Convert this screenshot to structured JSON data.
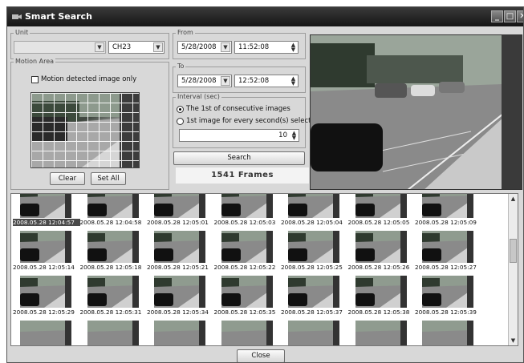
{
  "window": {
    "title": "Smart Search"
  },
  "unit": {
    "label": "Unit",
    "site_value": "",
    "channel_value": "CH23"
  },
  "motion_area": {
    "label": "Motion Area",
    "checkbox_label": "Motion detected image only",
    "checked": false,
    "clear_label": "Clear",
    "set_all_label": "Set All"
  },
  "from": {
    "label": "From",
    "date": "5/28/2008",
    "time": "11:52:08"
  },
  "to": {
    "label": "To",
    "date": "5/28/2008",
    "time": "12:52:08"
  },
  "interval": {
    "label": "Interval (sec)",
    "options": [
      "The 1st of consecutive images",
      "1st image for every second(s) selected"
    ],
    "selected_index": 0,
    "seconds": "10"
  },
  "search": {
    "button_label": "Search",
    "frames_text": "1541 Frames"
  },
  "thumbnails": {
    "captions": [
      [
        "2008.05.28 12:04:57",
        "2008.05.28 12:04:58",
        "2008.05.28 12:05:01",
        "2008.05.28 12:05:03",
        "2008.05.28 12:05:04",
        "2008.05.28 12:05:05",
        "2008.05.28 12:05:09"
      ],
      [
        "2008.05.28 12:05:14",
        "2008.05.28 12:05:18",
        "2008.05.28 12:05:21",
        "2008.05.28 12:05:22",
        "2008.05.28 12:05:25",
        "2008.05.28 12:05:26",
        "2008.05.28 12:05:27"
      ],
      [
        "2008.05.28 12:05:29",
        "2008.05.28 12:05:31",
        "2008.05.28 12:05:34",
        "2008.05.28 12:05:35",
        "2008.05.28 12:05:37",
        "2008.05.28 12:05:38",
        "2008.05.28 12:05:39"
      ]
    ],
    "selected": "2008.05.28 12:04:57"
  },
  "footer": {
    "close_label": "Close"
  },
  "icons": {
    "window": "camera-icon",
    "minimize": "minimize-icon",
    "maximize": "maximize-icon",
    "close": "close-icon"
  }
}
